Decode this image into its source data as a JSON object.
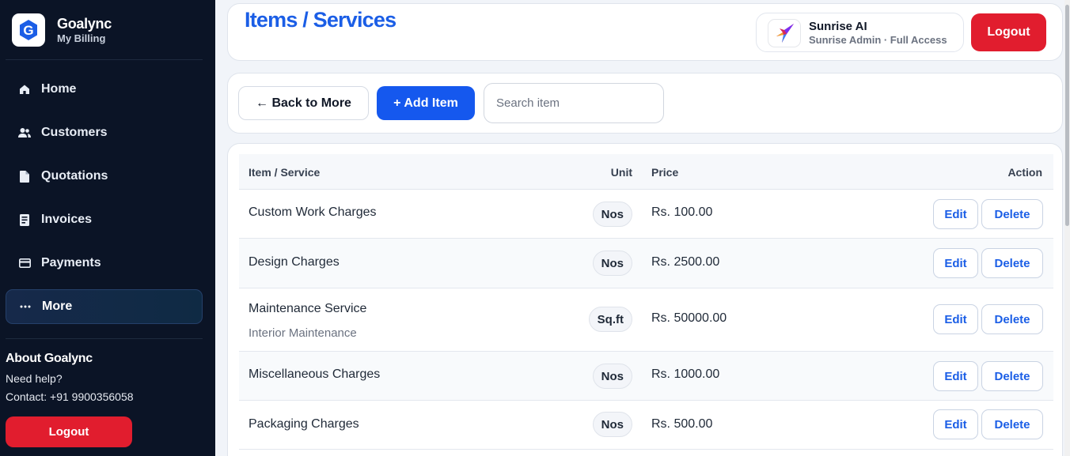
{
  "sidebar": {
    "brand_name": "Goalync",
    "brand_sub": "My Billing",
    "logo_letter": "G",
    "items": [
      {
        "label": "Home",
        "icon": "home-icon"
      },
      {
        "label": "Customers",
        "icon": "users-icon"
      },
      {
        "label": "Quotations",
        "icon": "document-icon"
      },
      {
        "label": "Invoices",
        "icon": "receipt-icon"
      },
      {
        "label": "Payments",
        "icon": "card-icon"
      },
      {
        "label": "More",
        "icon": "ellipsis-icon",
        "active": true
      }
    ],
    "about_title": "About Goalync",
    "help_text": "Need help?",
    "contact_text": "Contact: +91 9900356058",
    "logout_label": "Logout"
  },
  "header": {
    "title": "Items / Services",
    "user_name": "Sunrise AI",
    "user_role": "Sunrise Admin · Full Access",
    "logout_label": "Logout"
  },
  "toolbar": {
    "back_label": "← Back to More",
    "add_label": "+ Add Item",
    "search_placeholder": "Search item",
    "search_value": ""
  },
  "table": {
    "columns": {
      "name": "Item / Service",
      "unit": "Unit",
      "price": "Price",
      "action": "Action"
    },
    "rows": [
      {
        "name": "Custom Work Charges",
        "sub": "",
        "unit": "Nos",
        "price": "Rs. 100.00"
      },
      {
        "name": "Design Charges",
        "sub": "",
        "unit": "Nos",
        "price": "Rs. 2500.00"
      },
      {
        "name": "Maintenance Service",
        "sub": "Interior Maintenance",
        "unit": "Sq.ft",
        "price": "Rs. 50000.00"
      },
      {
        "name": "Miscellaneous Charges",
        "sub": "",
        "unit": "Nos",
        "price": "Rs. 1000.00"
      },
      {
        "name": "Packaging Charges",
        "sub": "",
        "unit": "Nos",
        "price": "Rs. 500.00"
      }
    ],
    "edit_label": "Edit",
    "delete_label": "Delete"
  },
  "colors": {
    "sidebar_bg": "#0b1426",
    "accent_blue": "#1558ee",
    "title_blue": "#1b5ee6",
    "logout_red": "#e11d2e"
  }
}
